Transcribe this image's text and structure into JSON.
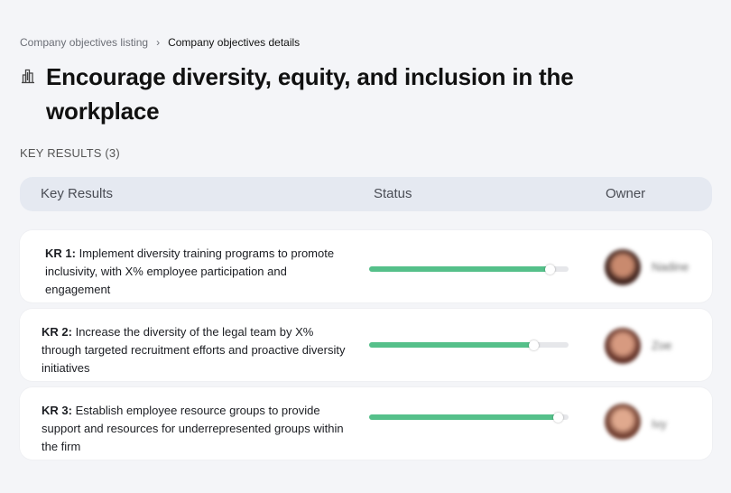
{
  "breadcrumb": {
    "parent": "Company objectives listing",
    "separator": "›",
    "current": "Company objectives details"
  },
  "title_icon": "building-icon",
  "title": "Encourage diversity, equity, and inclusion in the workplace",
  "section_label": "KEY RESULTS (3)",
  "table": {
    "columns": [
      "Key Results",
      "Status",
      "Owner"
    ],
    "rows": [
      {
        "kr_label": "KR 1:",
        "kr_text": "Implement diversity training programs to promote inclusivity, with X% employee participation and engagement",
        "progress": 0.91,
        "owner": "Nadine"
      },
      {
        "kr_label": "KR 2:",
        "kr_text": "Increase the diversity of the legal team by X% through targeted recruitment efforts and proactive diversity initiatives",
        "progress": 0.83,
        "owner": "Zoe"
      },
      {
        "kr_label": "KR 3:",
        "kr_text": "Establish employee resource groups to provide support and resources for underrepresented groups within the firm",
        "progress": 0.95,
        "owner": "Ivy"
      }
    ]
  },
  "colors": {
    "progress_fill": "#55c08a",
    "progress_track": "#e6e7ea",
    "header_bg": "#e5e9f1",
    "page_bg": "#f4f5f8"
  }
}
